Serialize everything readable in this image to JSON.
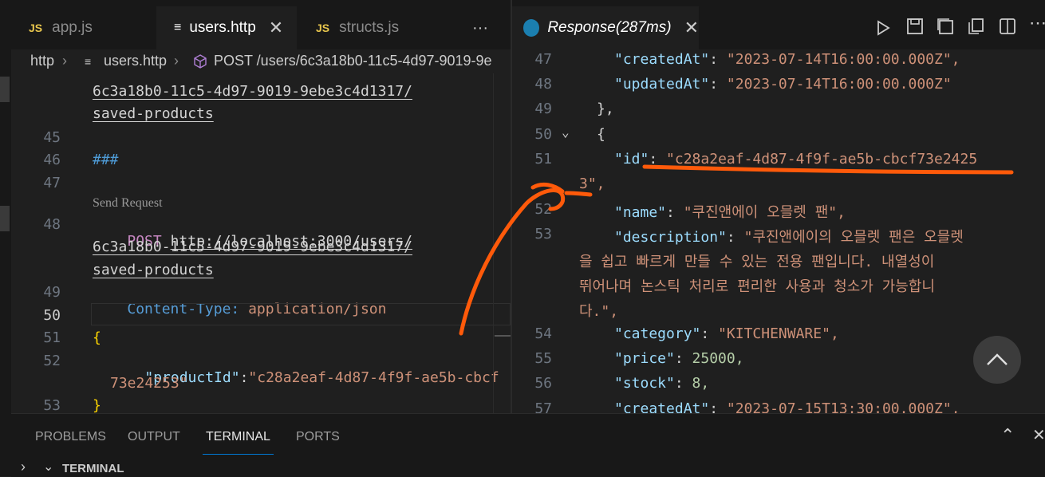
{
  "left_tabs": [
    {
      "label": "app.js",
      "badge": "JS",
      "active": false
    },
    {
      "label": "users.http",
      "active": true
    },
    {
      "label": "structs.js",
      "badge": "JS",
      "active": false
    }
  ],
  "right_tab": {
    "label": "Response(287ms)"
  },
  "breadcrumb": {
    "part1": "http",
    "part2": "users.http",
    "part3": "POST /users/6c3a18b0-11c5-4d97-9019-9e"
  },
  "editor": {
    "lines": [
      {
        "num": "",
        "text": "6c3a18b0-11c5-4d97-9019-9ebe3c4d1317/"
      },
      {
        "num": "",
        "text": "saved-products"
      },
      {
        "num": "45",
        "text": ""
      },
      {
        "num": "46",
        "text": "###"
      },
      {
        "num": "47",
        "text": ""
      },
      {
        "num": "48",
        "method": "POST",
        "url": "http://localhost:3000/users/"
      },
      {
        "num": "",
        "text": "6c3a18b0-11c5-4d97-9019-9ebe3c4d1317/"
      },
      {
        "num": "",
        "text": "saved-products"
      },
      {
        "num": "49",
        "header_key": "Content-Type:",
        "header_val": "application/json"
      },
      {
        "num": "50",
        "text": ""
      },
      {
        "num": "51",
        "text": "{"
      },
      {
        "num": "52",
        "key": "\"productId\"",
        "val": "\"c28a2eaf-4d87-4f9f-ae5b-cbcf"
      },
      {
        "num": "",
        "val": "73e24253\""
      },
      {
        "num": "53",
        "text": "}"
      }
    ],
    "codelens": "Send Request"
  },
  "response": {
    "lines": [
      {
        "num": "47",
        "key": "\"createdAt\"",
        "val": "\"2023-07-14T16:00:00.000Z\","
      },
      {
        "num": "48",
        "key": "\"updatedAt\"",
        "val": "\"2023-07-14T16:00:00.000Z\""
      },
      {
        "num": "49",
        "text": "},"
      },
      {
        "num": "50",
        "text": "{"
      },
      {
        "num": "51",
        "key": "\"id\"",
        "val": "\"c28a2eaf-4d87-4f9f-ae5b-cbcf73e2425"
      },
      {
        "num": "",
        "val": "3\","
      },
      {
        "num": "52",
        "key": "\"name\"",
        "val": "\"쿠진앤에이 오믈렛 팬\","
      },
      {
        "num": "53",
        "key": "\"description\"",
        "val": "\"쿠진앤에이의 오믈렛 팬은 오믈렛"
      },
      {
        "num": "",
        "val": "을 쉽고 빠르게 만들 수 있는 전용 팬입니다. 내열성이"
      },
      {
        "num": "",
        "val": "뛰어나며 논스틱 처리로 편리한 사용과 청소가 가능합니"
      },
      {
        "num": "",
        "val": "다.\","
      },
      {
        "num": "54",
        "key": "\"category\"",
        "val": "\"KITCHENWARE\","
      },
      {
        "num": "55",
        "key": "\"price\"",
        "val": "25000,"
      },
      {
        "num": "56",
        "key": "\"stock\"",
        "val": "8,"
      },
      {
        "num": "57",
        "key": "\"createdAt\"",
        "val": "\"2023-07-15T13:30:00.000Z\","
      }
    ]
  },
  "panel": {
    "tabs": [
      "PROBLEMS",
      "OUTPUT",
      "TERMINAL",
      "PORTS"
    ],
    "terminal_label": "TERMINAL"
  },
  "colors": {
    "annotation": "#ff5a0a",
    "accent": "#0078d4"
  }
}
